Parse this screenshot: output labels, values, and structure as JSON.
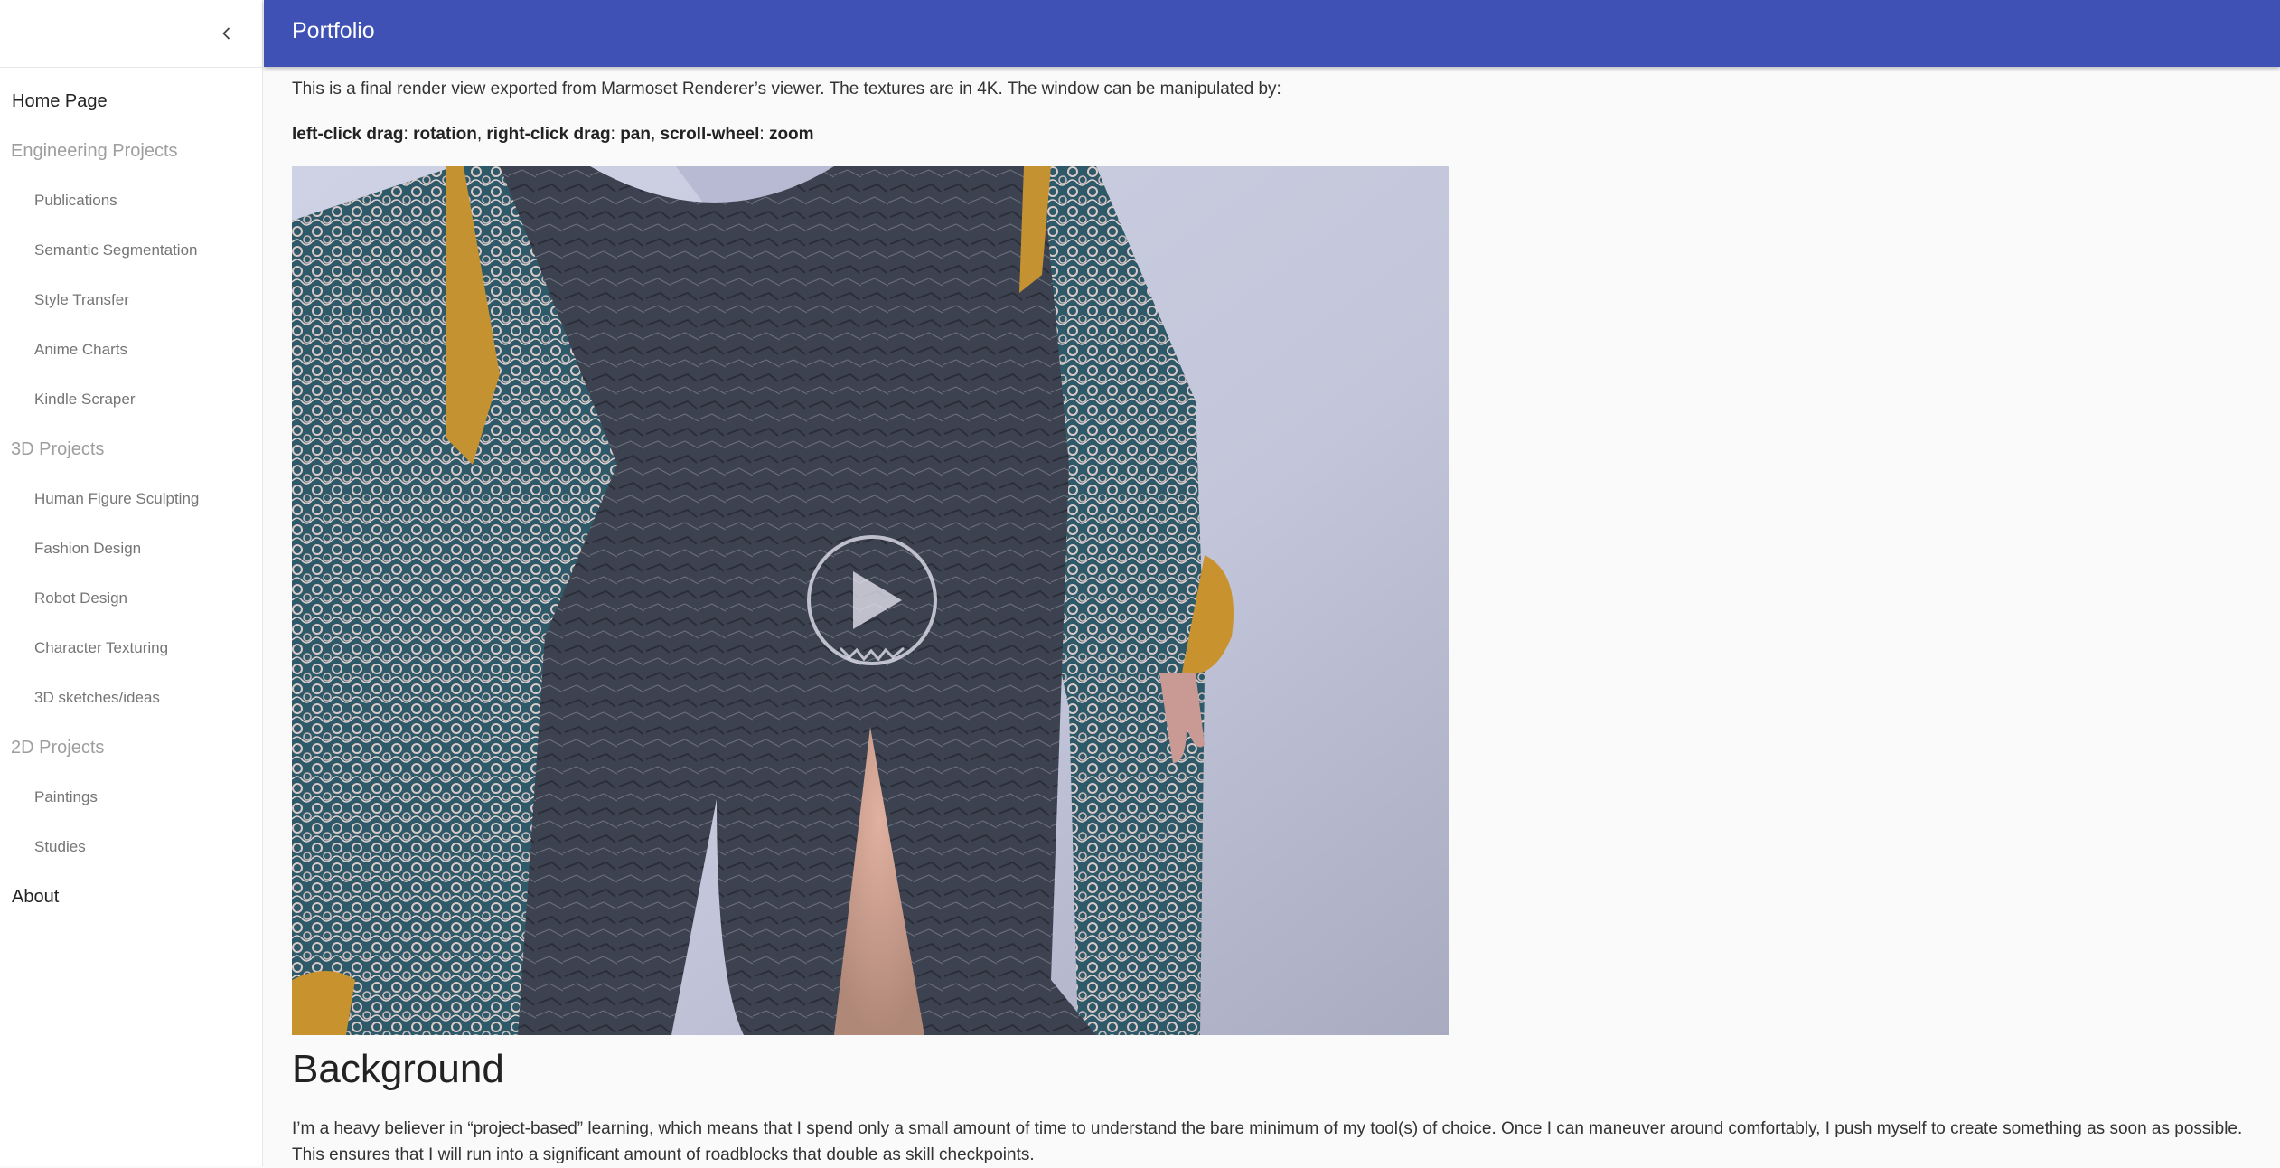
{
  "header": {
    "title": "Portfolio"
  },
  "sidebar": {
    "collapse_icon": "chevron-left-icon",
    "items": [
      {
        "label": "Home Page",
        "kind": "top"
      },
      {
        "label": "Engineering Projects",
        "kind": "section"
      },
      {
        "label": "Publications",
        "kind": "sub"
      },
      {
        "label": "Semantic Segmentation",
        "kind": "sub"
      },
      {
        "label": "Style Transfer",
        "kind": "sub"
      },
      {
        "label": "Anime Charts",
        "kind": "sub"
      },
      {
        "label": "Kindle Scraper",
        "kind": "sub"
      },
      {
        "label": "3D Projects",
        "kind": "section"
      },
      {
        "label": "Human Figure Sculpting",
        "kind": "sub"
      },
      {
        "label": "Fashion Design",
        "kind": "sub"
      },
      {
        "label": "Robot Design",
        "kind": "sub"
      },
      {
        "label": "Character Texturing",
        "kind": "sub"
      },
      {
        "label": "3D sketches/ideas",
        "kind": "sub"
      },
      {
        "label": "2D Projects",
        "kind": "section"
      },
      {
        "label": "Paintings",
        "kind": "sub"
      },
      {
        "label": "Studies",
        "kind": "sub"
      },
      {
        "label": "About",
        "kind": "top"
      }
    ]
  },
  "main": {
    "intro": "This is a final render view exported from Marmoset Renderer’s viewer. The textures are in 4K. The window can be manipulated by:",
    "controls": {
      "left_click": "left-click drag",
      "rotation": "rotation",
      "right_click": "right-click drag",
      "pan": "pan",
      "scroll": "scroll-wheel",
      "zoom": "zoom"
    },
    "viewer": {
      "play_icon": "play-icon"
    },
    "background_heading": "Background",
    "background_text": "I’m a heavy believer in “project-based” learning, which means that I spend only a small amount of time to understand the bare minimum of my tool(s) of choice. Once I can maneuver around comfortably, I push myself to create something as soon as possible. This ensures that I will run into a significant amount of roadblocks that double as skill checkpoints."
  },
  "colors": {
    "topbar": "#3f51b5",
    "section_label": "#9e9e9e",
    "sub_label": "#757575"
  }
}
